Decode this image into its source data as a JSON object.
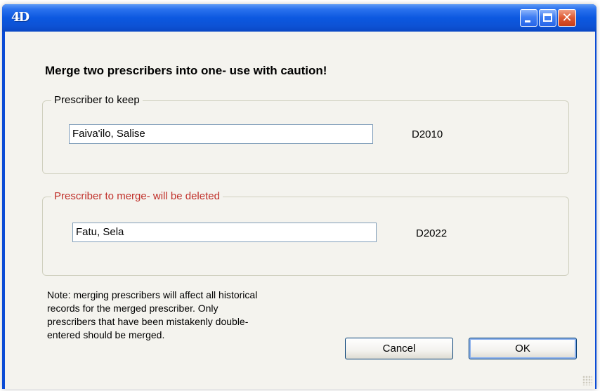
{
  "app": {
    "icon_label": "4D"
  },
  "dialog": {
    "title": "",
    "heading": "Merge two prescribers into one- use with caution!",
    "keep": {
      "legend": "Prescriber to keep",
      "name": "Faiva'ilo, Salise",
      "code": "D2010"
    },
    "merge": {
      "legend": "Prescriber to merge- will be deleted",
      "name": "Fatu, Sela",
      "code": "D2022"
    },
    "note": {
      "lines": [
        "Note: merging prescribers will affect all historical",
        "records for the merged prescriber. Only",
        "prescribers that have been mistakenly double-",
        "entered should be merged."
      ]
    },
    "buttons": {
      "cancel": "Cancel",
      "ok": "OK"
    }
  },
  "window_buttons": {
    "close_glyph": "✕"
  },
  "colors": {
    "titlebar": "#0C58E0",
    "client_bg": "#F4F3EE",
    "merge_legend": "#C0302A",
    "groupbox_border": "#D0D0BF"
  }
}
